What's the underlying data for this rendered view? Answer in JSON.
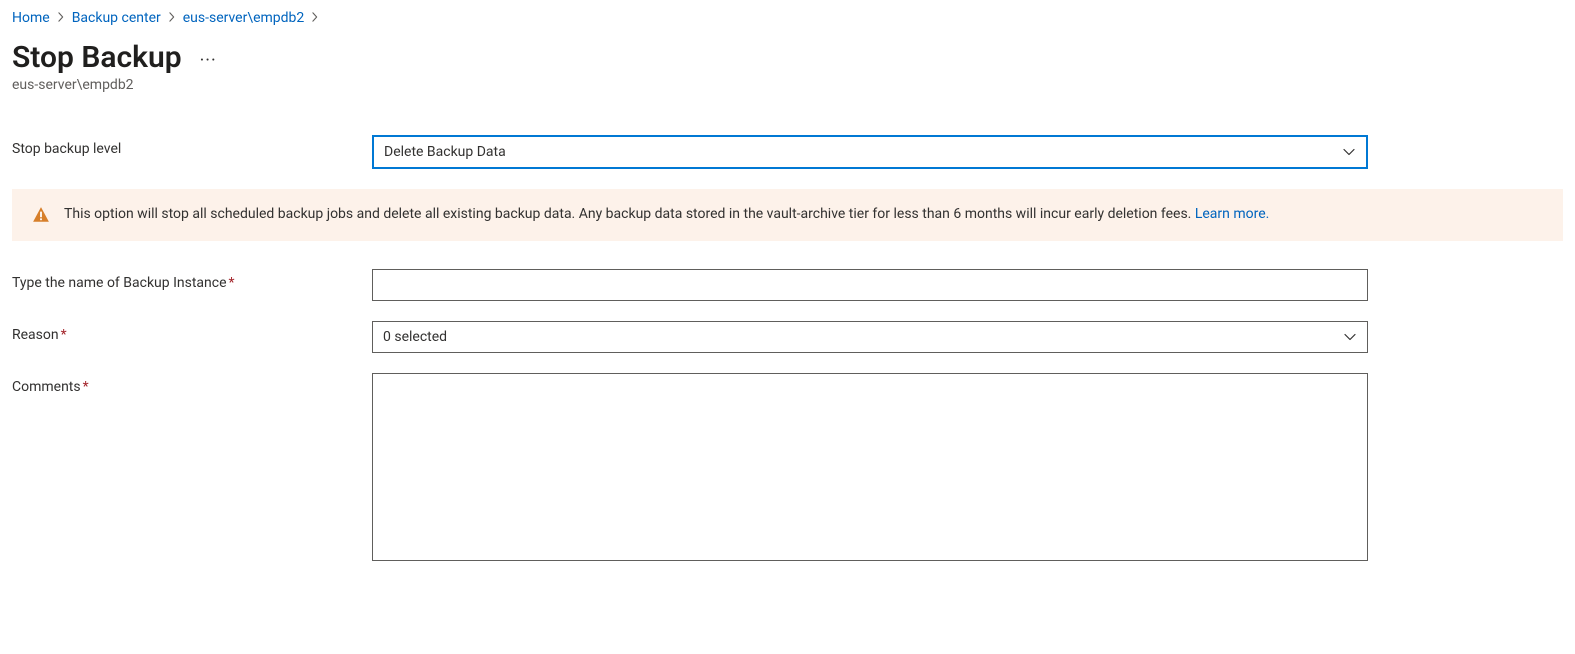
{
  "breadcrumb": {
    "items": [
      {
        "label": "Home"
      },
      {
        "label": "Backup center"
      },
      {
        "label": "eus-server\\empdb2"
      }
    ]
  },
  "header": {
    "title": "Stop Backup",
    "subtitle": "eus-server\\empdb2"
  },
  "form": {
    "stop_level": {
      "label": "Stop backup level",
      "value": "Delete Backup Data"
    },
    "alert": {
      "text": "This option will stop all scheduled backup jobs and delete all existing backup data. Any backup data stored in the vault-archive tier for less than 6 months will incur early deletion fees. ",
      "link": "Learn more."
    },
    "instance_name": {
      "label": "Type the name of Backup Instance",
      "value": ""
    },
    "reason": {
      "label": "Reason",
      "value": "0 selected"
    },
    "comments": {
      "label": "Comments",
      "value": ""
    }
  }
}
